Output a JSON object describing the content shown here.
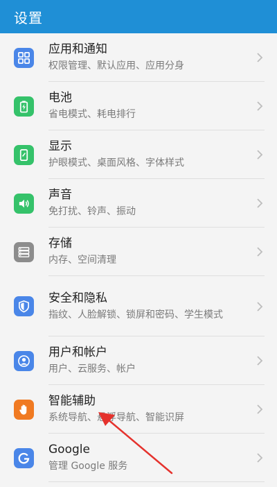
{
  "header": {
    "title": "设置"
  },
  "colors": {
    "header_bg": "#1f8fd6",
    "apps_icon": "#4a86e8",
    "battery_icon": "#35c26a",
    "display_icon": "#35c26a",
    "sound_icon": "#35c26a",
    "storage_icon": "#8c8c8c",
    "security_icon": "#4a86e8",
    "users_icon": "#4a86e8",
    "assist_icon": "#f07a22",
    "google_icon": "#4a86e8",
    "annotation_arrow": "#e5322d"
  },
  "items": [
    {
      "title": "应用和通知",
      "subtitle": "权限管理、默认应用、应用分身",
      "icon": "apps-grid-icon"
    },
    {
      "title": "电池",
      "subtitle": "省电模式、耗电排行",
      "icon": "battery-icon"
    },
    {
      "title": "显示",
      "subtitle": "护眼模式、桌面风格、字体样式",
      "icon": "display-icon"
    },
    {
      "title": "声音",
      "subtitle": "免打扰、铃声、振动",
      "icon": "speaker-icon"
    },
    {
      "title": "存储",
      "subtitle": "内存、空间清理",
      "icon": "storage-icon"
    },
    {
      "title": "安全和隐私",
      "subtitle": "指纹、人脸解锁、锁屏和密码、学生模式",
      "icon": "shield-icon"
    },
    {
      "title": "用户和帐户",
      "subtitle": "用户、云服务、帐户",
      "icon": "user-icon"
    },
    {
      "title": "智能辅助",
      "subtitle": "系统导航、悬浮导航、智能识屏",
      "icon": "hand-icon"
    },
    {
      "title": "Google",
      "subtitle": "管理 Google 服务",
      "icon": "google-icon"
    }
  ]
}
